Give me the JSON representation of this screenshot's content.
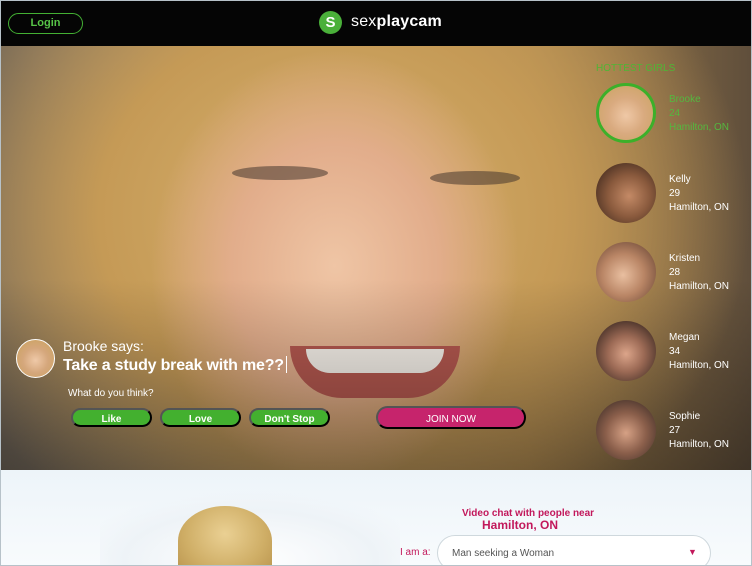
{
  "header": {
    "login_label": "Login",
    "brand": {
      "logo_letter": "S",
      "name_light": "sex",
      "name_bold": "playcam"
    }
  },
  "hero": {
    "says_name": "Brooke says:",
    "says_message": "Take a study break with me??",
    "prompt": "What do you think?",
    "reactions": [
      "Like",
      "Love",
      "Don't Stop"
    ],
    "join_label": "JOIN NOW"
  },
  "hottest": {
    "title": "HOTTEST GIRLS",
    "girls": [
      {
        "name": "Brooke",
        "age": "24",
        "city": "Hamilton, ON"
      },
      {
        "name": "Kelly",
        "age": "29",
        "city": "Hamilton, ON"
      },
      {
        "name": "Kristen",
        "age": "28",
        "city": "Hamilton, ON"
      },
      {
        "name": "Megan",
        "age": "34",
        "city": "Hamilton, ON"
      },
      {
        "name": "Sophie",
        "age": "27",
        "city": "Hamilton, ON"
      }
    ]
  },
  "search": {
    "near_title": "Video chat with people near",
    "near_city": "Hamilton, ON",
    "iam_label": "I am a:",
    "seeking_value": "Man seeking a Woman",
    "arrow_glyph": "▼"
  },
  "colors": {
    "accent_green": "#43b02f",
    "accent_pink": "#c6246c",
    "topbar": "#050505"
  }
}
